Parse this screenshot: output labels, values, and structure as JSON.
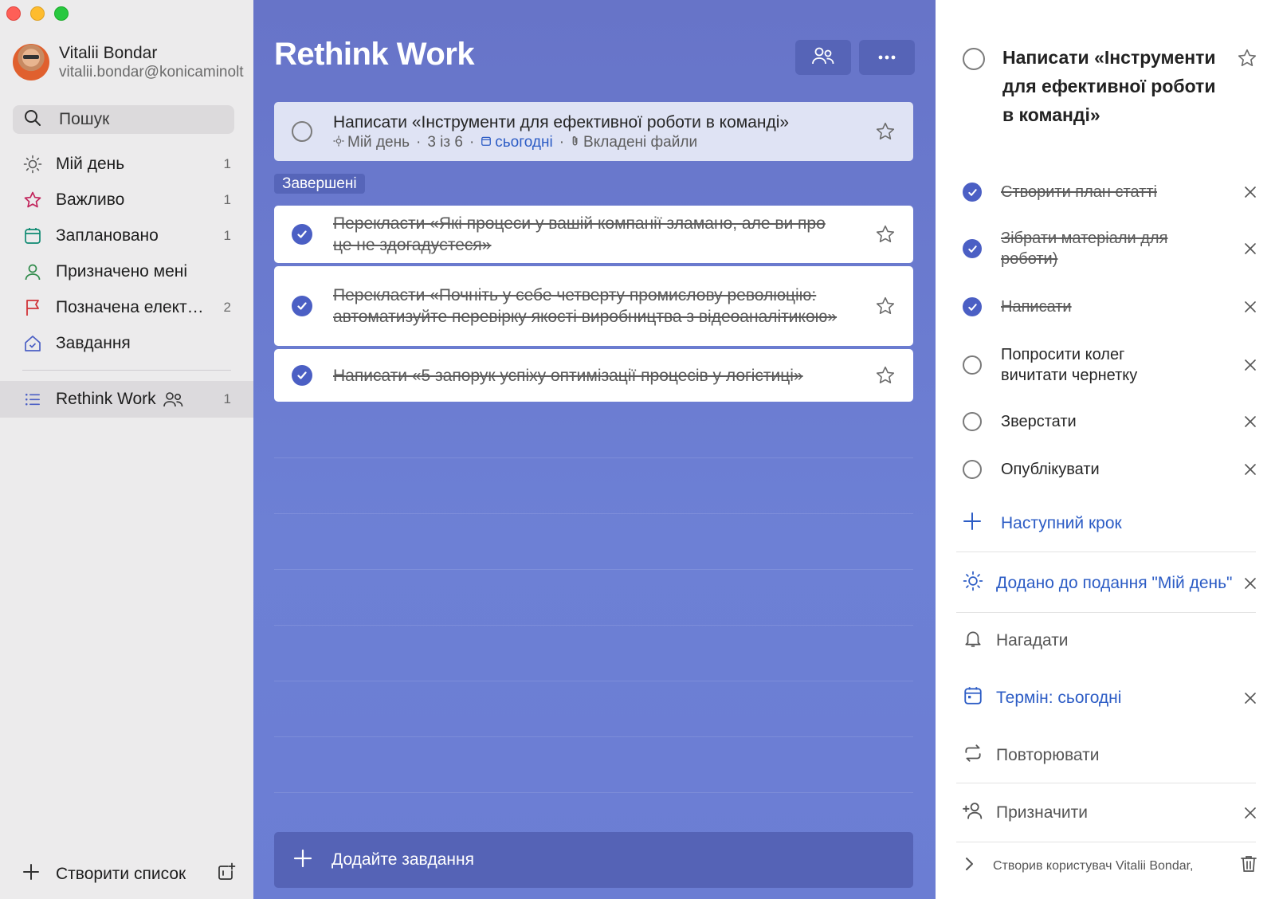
{
  "sidebar": {
    "profile": {
      "name": "Vitalii Bondar",
      "email": "vitalii.bondar@konicaminolta"
    },
    "search": {
      "label": "Пошук"
    },
    "items": [
      {
        "label": "Мій день",
        "count": "1",
        "icon": "sun-icon",
        "color": "#5a5a5a"
      },
      {
        "label": "Важливо",
        "count": "1",
        "icon": "star-icon",
        "color": "#c2255c"
      },
      {
        "label": "Заплановано",
        "count": "1",
        "icon": "calendar-icon",
        "color": "#0f8a72"
      },
      {
        "label": "Призначено мені",
        "count": "",
        "icon": "person-icon",
        "color": "#2f8a4a"
      },
      {
        "label": "Позначена елект…",
        "count": "2",
        "icon": "flag-icon",
        "color": "#d13438"
      },
      {
        "label": "Завдання",
        "count": "",
        "icon": "home-icon",
        "color": "#4b5fc4"
      }
    ],
    "active_list": {
      "label": "Rethink Work",
      "count": "1",
      "icon": "list-icon"
    },
    "footer": {
      "label": "Створити список"
    }
  },
  "main": {
    "title": "Rethink Work",
    "accent": "#6774c8",
    "open_task": {
      "title": "Написати «Інструменти для ефективної роботи в команді»",
      "meta_myday": "Мій день",
      "meta_steps": "3 із 6",
      "meta_due": "сьогодні",
      "meta_attach": "Вкладені файли"
    },
    "completed_label": "Завершені",
    "completed": [
      {
        "title": "Перекласти «Які процеси у вашій компанії зламано, але ви про це не здогадуєтеся»"
      },
      {
        "title": "Перекласти «Почніть у себе четверту промислову революцію: автоматизуйте перевірку якості виробництва з відеоаналітикою»"
      },
      {
        "title": "Написати «5 запорук успіху оптимізації процесів у логістиці»"
      }
    ],
    "add_task": "Додайте завдання"
  },
  "detail": {
    "title": "Написати «Інструменти для ефективної роботи в команді»",
    "steps": [
      {
        "label": "Створити план статті",
        "done": true
      },
      {
        "label": "Зібрати матеріали для роботи)",
        "done": true
      },
      {
        "label": "Написати",
        "done": true
      },
      {
        "label": "Попросити колег вичитати чернетку",
        "done": false
      },
      {
        "label": "Зверстати",
        "done": false
      },
      {
        "label": "Опублікувати",
        "done": false
      }
    ],
    "add_step": "Наступний крок",
    "my_day": "Додано до подання \"Мій день\"",
    "remind": "Нагадати",
    "due": "Термін: сьогодні",
    "repeat": "Повторювати",
    "assign": "Призначити",
    "footer": "Створив користувач Vitalii Bondar,"
  }
}
